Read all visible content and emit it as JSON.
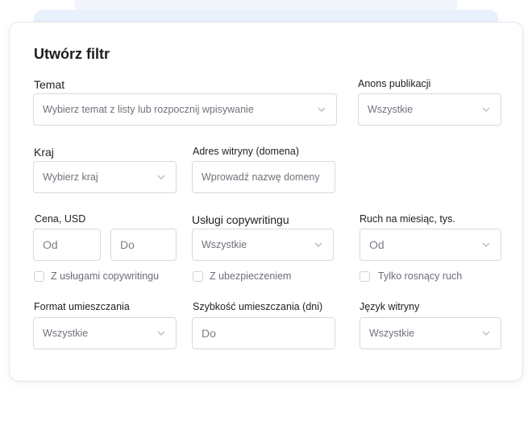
{
  "form": {
    "title": "Utwórz filtr",
    "topic": {
      "label": "Temat",
      "placeholder": "Wybierz temat z listy lub rozpocznij wpisywanie"
    },
    "announcement": {
      "label": "Anons publikacji",
      "value": "Wszystkie"
    },
    "country": {
      "label": "Kraj",
      "placeholder": "Wybierz kraj"
    },
    "site_address": {
      "label": "Adres witryny (domena)",
      "placeholder": "Wprowadź nazwę domeny"
    },
    "price": {
      "label": "Cena, USD",
      "from_placeholder": "Od",
      "to_placeholder": "Do"
    },
    "copywriting": {
      "label": "Usługi copywritingu",
      "value": "Wszystkie"
    },
    "traffic": {
      "label": "Ruch na miesiąc, tys.",
      "placeholder": "Od"
    },
    "checkboxes": {
      "with_copywriting": "Z usługami copywritingu",
      "insured": "Z ubezpieczeniem",
      "growing_traffic": "Tylko rosnący ruch"
    },
    "placement_format": {
      "label": "Format umieszczania",
      "value": "Wszystkie"
    },
    "placement_speed": {
      "label": "Szybkość umieszczania (dni)",
      "placeholder": "Do"
    },
    "site_language": {
      "label": "Język witryny",
      "value": "Wszystkie"
    }
  },
  "icons": {
    "dropdown": "chevron-down-icon",
    "checkbox": "checkbox-icon"
  },
  "colors": {
    "border": "#d6d9df",
    "placeholder": "#6f737b",
    "accent_bg": "#e9f1fd",
    "title": "#1c1d21"
  }
}
